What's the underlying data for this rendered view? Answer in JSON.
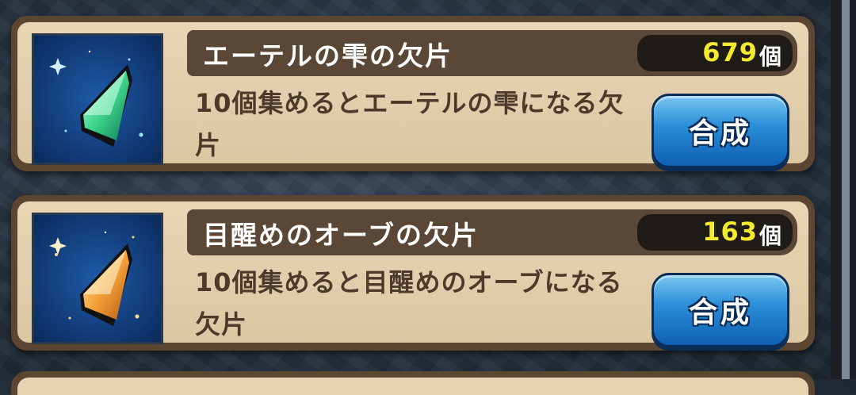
{
  "items": [
    {
      "name": "エーテルの雫の欠片",
      "count": "679",
      "unit": "個",
      "description": "10個集めるとエーテルの雫になる欠片",
      "button_label": "合成",
      "crystal_color": "#3fd68a"
    },
    {
      "name": "目醒めのオーブの欠片",
      "count": "163",
      "unit": "個",
      "description": "10個集めると目醒めのオーブになる欠片",
      "button_label": "合成",
      "crystal_color": "#f5a23a"
    }
  ],
  "colors": {
    "card_frame": "#5b4631",
    "card_fill": "#e8d6b6",
    "count_highlight": "#f4ea2e",
    "button_blue": "#2a8fd8"
  }
}
